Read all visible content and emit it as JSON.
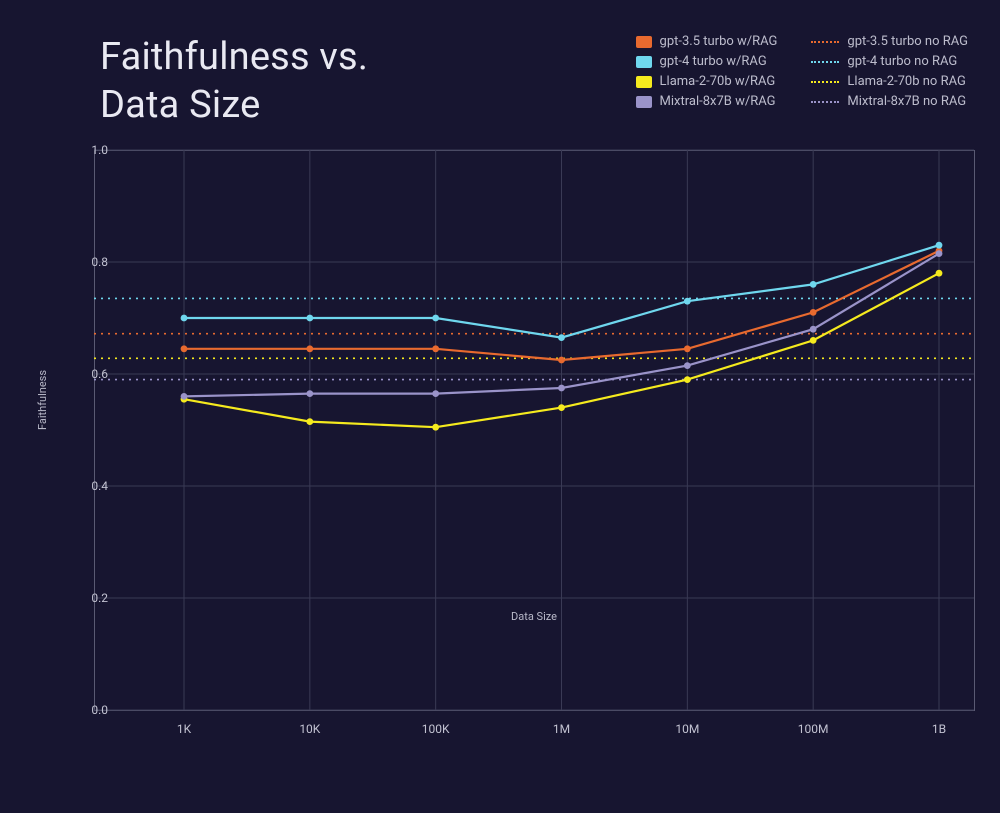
{
  "title": "Faithfulness vs.\nData Size",
  "legend_solid": [
    {
      "label": "gpt-3.5 turbo w/RAG",
      "color": "#e86a2f"
    },
    {
      "label": "gpt-4 turbo w/RAG",
      "color": "#6fd7ee"
    },
    {
      "label": "Llama-2-70b w/RAG",
      "color": "#f5ea1e"
    },
    {
      "label": "Mixtral-8x7B w/RAG",
      "color": "#9a93c9"
    }
  ],
  "legend_dashed": [
    {
      "label": "gpt-3.5 turbo no RAG",
      "color": "#e86a2f"
    },
    {
      "label": "gpt-4 turbo no RAG",
      "color": "#6fd7ee"
    },
    {
      "label": "Llama-2-70b no RAG",
      "color": "#f5ea1e"
    },
    {
      "label": "Mixtral-8x7B no RAG",
      "color": "#9a93c9"
    }
  ],
  "axes": {
    "ylabel": "Faithfulness",
    "xlabel": "Data Size",
    "y_ticks": [
      "0.0",
      "0.2",
      "0.4",
      "0.6",
      "0.8",
      "1.0"
    ],
    "x_ticks": [
      "1K",
      "10K",
      "100K",
      "1M",
      "10M",
      "100M",
      "1B"
    ]
  },
  "chart_data": {
    "type": "line",
    "xlabel": "Data Size",
    "ylabel": "Faithfulness",
    "ylim": [
      0.0,
      1.0
    ],
    "categories": [
      "1K",
      "10K",
      "100K",
      "1M",
      "10M",
      "100M",
      "1B"
    ],
    "series": [
      {
        "name": "gpt-3.5 turbo w/RAG",
        "style": "solid",
        "color": "#e86a2f",
        "values": [
          0.645,
          0.645,
          0.645,
          0.625,
          0.645,
          0.71,
          0.82
        ]
      },
      {
        "name": "gpt-4 turbo w/RAG",
        "style": "solid",
        "color": "#6fd7ee",
        "values": [
          0.7,
          0.7,
          0.7,
          0.665,
          0.73,
          0.76,
          0.83
        ]
      },
      {
        "name": "Llama-2-70b w/RAG",
        "style": "solid",
        "color": "#f5ea1e",
        "values": [
          0.555,
          0.515,
          0.505,
          0.54,
          0.59,
          0.66,
          0.78
        ]
      },
      {
        "name": "Mixtral-8x7B w/RAG",
        "style": "solid",
        "color": "#9a93c9",
        "values": [
          0.56,
          0.565,
          0.565,
          0.575,
          0.615,
          0.68,
          0.815
        ]
      },
      {
        "name": "gpt-3.5 turbo no RAG",
        "style": "dashed",
        "color": "#e86a2f",
        "value": 0.672
      },
      {
        "name": "gpt-4 turbo no RAG",
        "style": "dashed",
        "color": "#6fd7ee",
        "value": 0.735
      },
      {
        "name": "Llama-2-70b no RAG",
        "style": "dashed",
        "color": "#f5ea1e",
        "value": 0.628
      },
      {
        "name": "Mixtral-8x7B no RAG",
        "style": "dashed",
        "color": "#9a93c9",
        "value": 0.59
      }
    ]
  }
}
